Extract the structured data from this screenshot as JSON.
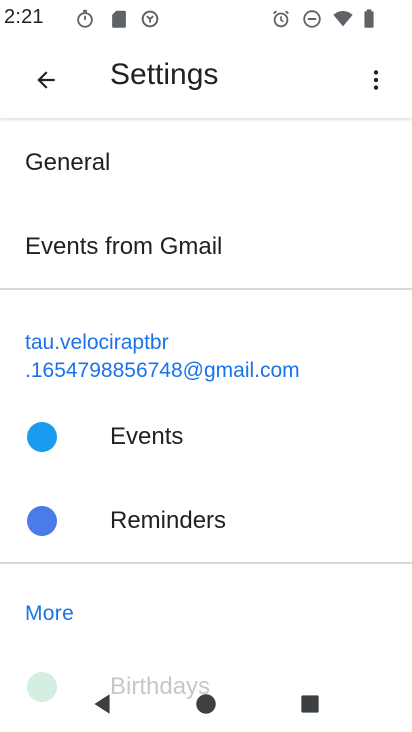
{
  "status_bar": {
    "time": "2:21",
    "icons": [
      "stopwatch-icon",
      "sd-card-icon",
      "no-sync-icon",
      "alarm-icon",
      "do-not-disturb-icon",
      "wifi-icon",
      "battery-icon"
    ]
  },
  "app_bar": {
    "title": "Settings",
    "back_icon": "arrow-back-icon",
    "overflow_icon": "more-vert-icon"
  },
  "list": {
    "general_label": "General",
    "events_from_gmail_label": "Events from Gmail",
    "account": {
      "email_line1": "tau.velociraptbr",
      "email_line2": ".1654798856748@gmail.com",
      "calendars": [
        {
          "label": "Events",
          "color": "#1a9bf0"
        },
        {
          "label": "Reminders",
          "color": "#4a7be8"
        }
      ]
    },
    "more_header": "More",
    "more_items": [
      {
        "label": "Birthdays",
        "color": "#57bb8a"
      }
    ]
  },
  "nav_bar": {
    "buttons": [
      "back-triangle-icon",
      "home-circle-icon",
      "recents-square-icon"
    ]
  },
  "colors": {
    "accent": "#1a73e8",
    "text_primary": "#202124",
    "divider": "#d9d9d9"
  }
}
